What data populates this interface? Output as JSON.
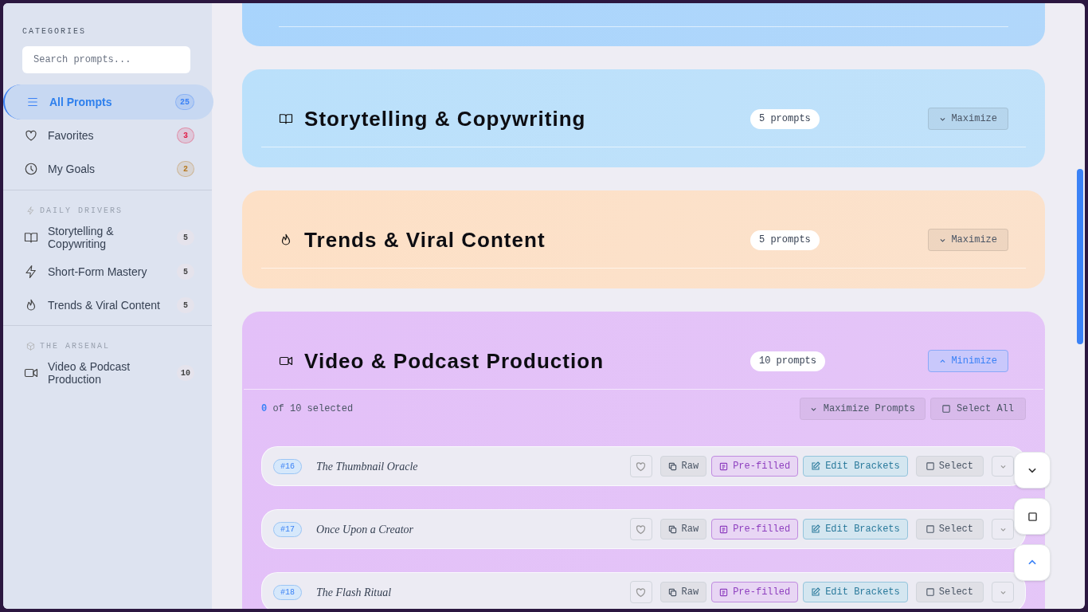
{
  "sidebar": {
    "heading": "CATEGORIES",
    "search": {
      "placeholder": "Search prompts..."
    },
    "items": [
      {
        "kind": "list",
        "label": "All Prompts",
        "count": "25",
        "color": "#3b82f6",
        "selected": true
      },
      {
        "kind": "heart",
        "label": "Favorites",
        "count": "3",
        "color": "#e11d48",
        "selected": false
      },
      {
        "kind": "clock",
        "label": "My Goals",
        "count": "2",
        "color": "#b7791f",
        "selected": false
      }
    ],
    "sections": [
      {
        "kind": "bolt",
        "title": "DAILY DRIVERS",
        "items": [
          {
            "kind": "book",
            "label": "Storytelling & Copywriting",
            "count": "5",
            "selected": false
          },
          {
            "kind": "bolt",
            "label": "Short-Form Mastery",
            "count": "5",
            "selected": false
          },
          {
            "kind": "flame",
            "label": "Trends & Viral Content",
            "count": "5",
            "selected": false
          }
        ]
      },
      {
        "kind": "cube",
        "title": "THE ARSENAL",
        "items": [
          {
            "kind": "video",
            "label": "Video & Podcast Production",
            "count": "10",
            "selected": false
          }
        ]
      }
    ]
  },
  "categories": [
    {
      "kind": "cut",
      "color": "#a8d4fc"
    },
    {
      "kind": "card",
      "title": "Storytelling & Copywriting",
      "count": "5 prompts",
      "toggle": "Maximize",
      "expanded": false,
      "color": "#bae0fb"
    },
    {
      "kind": "card",
      "title": "Trends & Viral Content",
      "count": "5 prompts",
      "toggle": "Maximize",
      "expanded": false,
      "color": "#fde0c6"
    },
    {
      "kind": "card",
      "title": "Video & Podcast Production",
      "count": "10 prompts",
      "toggle": "Minimize",
      "expanded": true,
      "color": "#e3c0f8",
      "selection": {
        "count": "0",
        "text": "of 10 selected"
      },
      "expand_all": "Maximize Prompts",
      "select_all": "Select All",
      "prompts": [
        {
          "number": "#16",
          "title": "The Thumbnail Oracle",
          "favorite": false,
          "raw": "Raw",
          "prefilled": "Pre-filled",
          "edit": "Edit Brackets",
          "select": "Select"
        },
        {
          "number": "#17",
          "title": "Once Upon a Creator",
          "favorite": false,
          "raw": "Raw",
          "prefilled": "Pre-filled",
          "edit": "Edit Brackets",
          "select": "Select"
        },
        {
          "number": "#18",
          "title": "The Flash Ritual",
          "favorite": false,
          "raw": "Raw",
          "prefilled": "Pre-filled",
          "edit": "Edit Brackets",
          "select": "Select"
        }
      ]
    }
  ]
}
